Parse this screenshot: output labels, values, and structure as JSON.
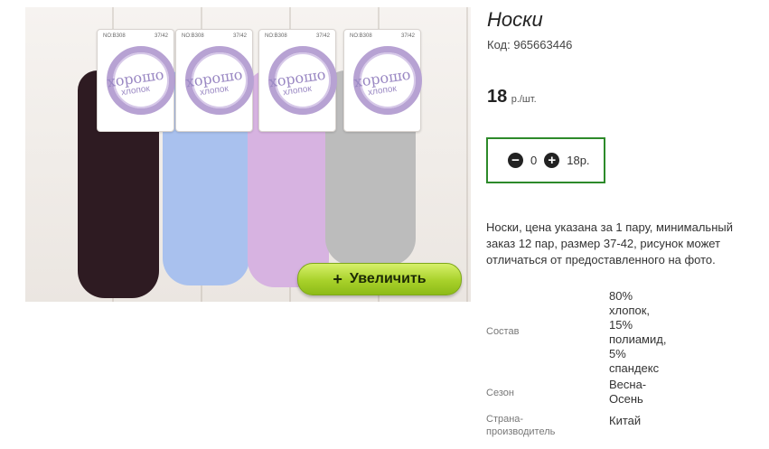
{
  "product": {
    "title": "Носки",
    "code_label": "Код:",
    "code_value": "965663446",
    "price_value": "18",
    "price_unit": "р./шт.",
    "description": "Носки, цена указана за 1 пару, минимальный заказ 12 пар, размер 37-42, рисунок может отличаться от предоставленного на фото."
  },
  "image": {
    "zoom_plus": "+",
    "zoom_label": "Увеличить",
    "cards": [
      {
        "code": "NO:B308",
        "size": "37/42",
        "brand": "хорошо",
        "sub": "хлопок"
      },
      {
        "code": "NO:B308",
        "size": "37/42",
        "brand": "хорошо",
        "sub": "хлопок"
      },
      {
        "code": "NO:B308",
        "size": "37/42",
        "brand": "хорошо",
        "sub": "хлопок"
      },
      {
        "code": "NO:B308",
        "size": "37/42",
        "brand": "хорошо",
        "sub": "хлопок"
      }
    ],
    "sock_colors": [
      "#2e1b22",
      "#a9c1ee",
      "#d7b3e1",
      "#bcbcbc"
    ]
  },
  "quantity": {
    "minus_icon": "minus-circle-icon",
    "plus_icon": "plus-circle-icon",
    "value": "0",
    "total": "18р."
  },
  "specs": [
    {
      "label": "Состав",
      "value": "80%\nхлопок,\n15%\nполиамид,\n5%\nспандекс"
    },
    {
      "label": "Сезон",
      "value": "Весна-\nОсень"
    },
    {
      "label": "Страна-\nпроизводитель",
      "value": "Китай"
    }
  ],
  "colors": {
    "accent_green_border": "#2d8a2a",
    "zoom_button": "#a8d12a"
  }
}
